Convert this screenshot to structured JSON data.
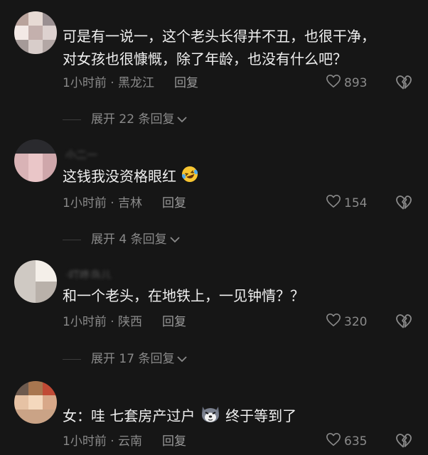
{
  "comments": [
    {
      "text_line1": "可是有一说一，这个老头长得并不丑，也很干净，",
      "text_line2": "对女孩也很慷慨，除了年龄，也没有什么吧？",
      "meta": "1小时前 · 黑龙江",
      "reply_label": "回复",
      "likes": "893",
      "expand_label": "展开 22 条回复"
    },
    {
      "username": "小二一",
      "text_line1": "这钱我没资格眼红",
      "meta": "1小时前 · 吉林",
      "reply_label": "回复",
      "likes": "154",
      "expand_label": "展开 4 条回复"
    },
    {
      "username": "·叮咚鸟儿",
      "text_line1": "和一个老头，在地铁上，一见钟情？？",
      "meta": "1小时前 · 陕西",
      "reply_label": "回复",
      "likes": "320",
      "expand_label": "展开 17 条回复"
    },
    {
      "text_line1_a": "女：哇 七套房产过户",
      "text_line1_b": "终于等到了",
      "meta": "1小时前 · 云南",
      "reply_label": "回复",
      "likes": "635"
    }
  ],
  "icons": {
    "heart": "heart-outline-icon",
    "dislike": "broken-heart-icon",
    "chevron": "chevron-down-icon",
    "emoji1": "laughing-crying-emoji-icon",
    "emoji2": "husky-dog-emoji-icon"
  },
  "colors": {
    "background": "#161616",
    "text": "#f0f0f0",
    "meta": "#8a8a8a"
  }
}
